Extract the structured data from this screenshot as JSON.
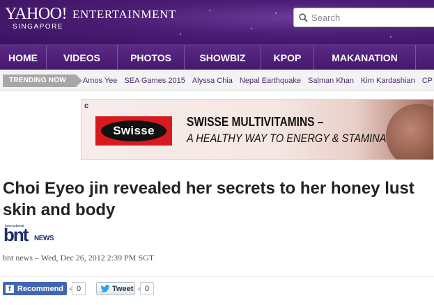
{
  "header": {
    "logo_brand": "YAHOO!",
    "logo_section": "ENTERTAINMENT",
    "logo_region": "SINGAPORE",
    "search_placeholder": "Search"
  },
  "nav": {
    "items": [
      {
        "label": "HOME"
      },
      {
        "label": "VIDEOS"
      },
      {
        "label": "PHOTOS"
      },
      {
        "label": "SHOWBIZ"
      },
      {
        "label": "KPOP"
      },
      {
        "label": "MAKANATION"
      }
    ]
  },
  "trending": {
    "label": "TRENDING NOW",
    "links": [
      "Amos Yee",
      "SEA Games 2015",
      "Alyssa Chia",
      "Nepal Earthquake",
      "Salman Khan",
      "Kim Kardashian",
      "CP"
    ]
  },
  "ad": {
    "choice_icon": "c",
    "brand": "Swisse",
    "line1": "SWISSE MULTIVITAMINS –",
    "line2": "A HEALTHY WAY TO ENERGY & STAMINA"
  },
  "article": {
    "headline": "Choi Eyeo jin revealed her secrets to her honey lust skin and body",
    "source_logo": {
      "main": "bnt",
      "top": "International",
      "suffix": "NEWS"
    },
    "byline": "bnt news – Wed, Dec 26, 2012 2:39 PM SGT"
  },
  "social": {
    "fb_label": "Recommend",
    "fb_icon": "f",
    "fb_count": "0",
    "tw_label": "Tweet",
    "tw_count": "0"
  },
  "colors": {
    "header_purple": "#4b1d74",
    "nav_purple": "#5a2a86",
    "trend_link": "#4a2a6e",
    "facebook_blue": "#4267b2",
    "swisse_red": "#d71920"
  }
}
